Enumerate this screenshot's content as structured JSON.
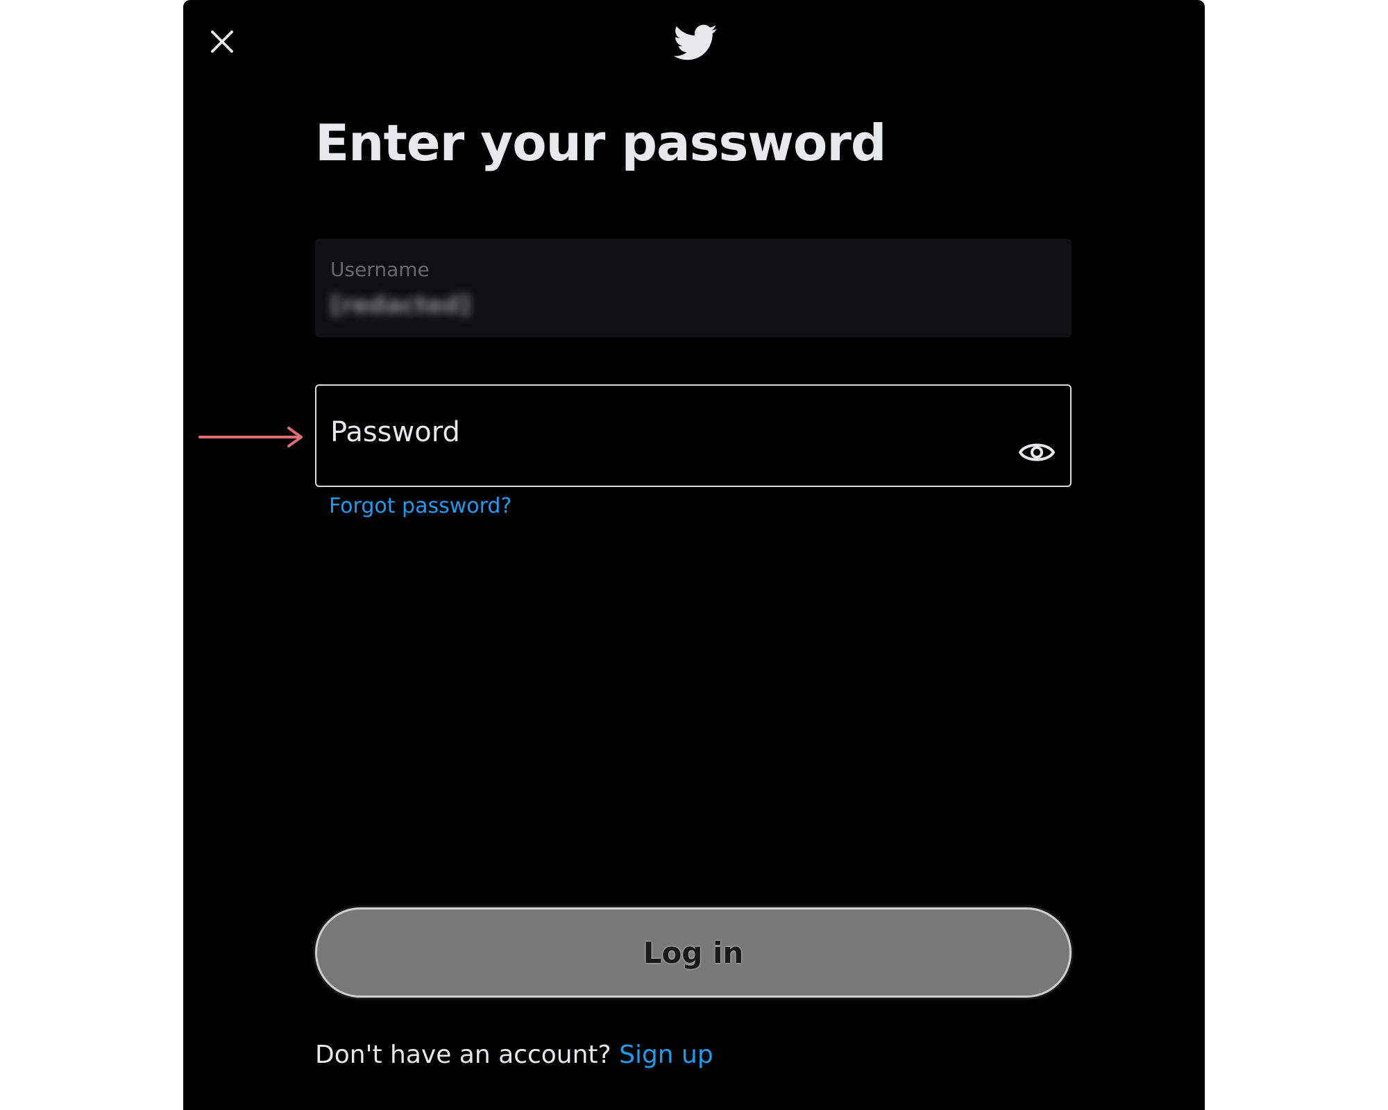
{
  "dialog": {
    "title": "Enter your password",
    "close_icon": "close-icon",
    "logo_icon": "twitter-bird-icon"
  },
  "username_field": {
    "label": "Username",
    "value": "[redacted]"
  },
  "password_field": {
    "label": "Password",
    "value": "",
    "toggle_icon": "eye-icon"
  },
  "annotation": {
    "arrow_icon": "right-arrow-icon",
    "arrow_color": "#e06c75"
  },
  "links": {
    "forgot_password": "Forgot password?"
  },
  "actions": {
    "login_label": "Log in"
  },
  "footer": {
    "prompt": "Don't have an account? ",
    "signup_label": "Sign up"
  },
  "colors": {
    "background": "#000000",
    "accent": "#1d9bf0",
    "text": "#e7e9ea",
    "login_button": "#787878"
  }
}
